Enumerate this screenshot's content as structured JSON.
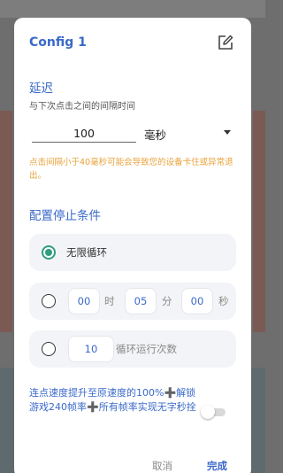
{
  "dialog": {
    "title": "Config 1",
    "edit_icon": "edit-icon"
  },
  "delay": {
    "title": "延迟",
    "hint": "与下次点击之间的间隔时间",
    "value": "100",
    "unit": "毫秒",
    "warning": "点击间隔小于40毫秒可能会导致您的设备卡住或异常退出。"
  },
  "stop_conditions": {
    "title": "配置停止条件",
    "infinite_loop": {
      "label": "无限循环",
      "selected": true
    },
    "timer": {
      "selected": false,
      "hours": "00",
      "hours_unit": "时",
      "minutes": "05",
      "minutes_unit": "分",
      "seconds": "00",
      "seconds_unit": "秒"
    },
    "loop_count": {
      "selected": false,
      "value": "10",
      "label": "循环运行次数"
    }
  },
  "promo": {
    "text": "连点速度提升至原速度的100%➕解锁游戏240帧率➕所有帧率实现无字秒拴",
    "toggle_on": false
  },
  "footer": {
    "cancel_label": "取消",
    "done_label": "完成"
  },
  "colors": {
    "accent": "#3a69c9",
    "radio_checked": "#2f9e7e",
    "warning": "#e8a23a"
  }
}
